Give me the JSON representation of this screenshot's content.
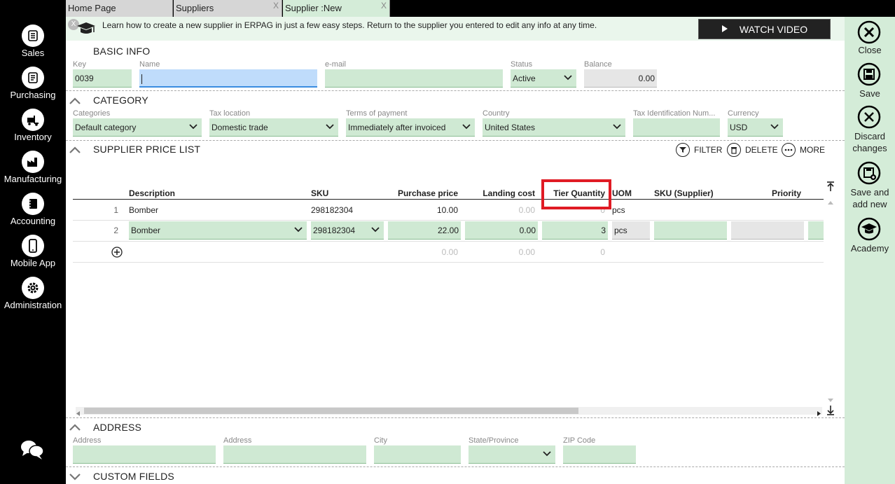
{
  "nav": {
    "items": [
      {
        "label": "Sales",
        "icon": "sales-icon"
      },
      {
        "label": "Purchasing",
        "icon": "purchasing-icon"
      },
      {
        "label": "Inventory",
        "icon": "inventory-icon"
      },
      {
        "label": "Manufacturing",
        "icon": "manufacturing-icon"
      },
      {
        "label": "Accounting",
        "icon": "accounting-icon"
      },
      {
        "label": "Mobile App",
        "icon": "mobile-icon"
      },
      {
        "label": "Administration",
        "icon": "gear-icon"
      }
    ]
  },
  "tabs": [
    {
      "label": "Home Page"
    },
    {
      "label": "Suppliers",
      "close": "X"
    },
    {
      "label": "Supplier :New",
      "close": "X"
    }
  ],
  "banner": {
    "close": "X",
    "text": "Learn how to create a new supplier in ERPAG in just a few easy steps. Return to the supplier you entered to edit any info at any time.",
    "watch_video": "WATCH VIDEO"
  },
  "basic_info": {
    "title": "BASIC INFO",
    "key_label": "Key",
    "key_value": "0039",
    "name_label": "Name",
    "name_value": "",
    "email_label": "e-mail",
    "email_value": "",
    "status_label": "Status",
    "status_value": "Active",
    "balance_label": "Balance",
    "balance_value": "0.00"
  },
  "category": {
    "title": "CATEGORY",
    "categories_label": "Categories",
    "categories_value": "Default category",
    "tax_location_label": "Tax location",
    "tax_location_value": "Domestic trade",
    "terms_label": "Terms of payment",
    "terms_value": "Immediately after invoiced",
    "country_label": "Country",
    "country_value": "United States",
    "tax_id_label": "Tax Identification Num...",
    "tax_id_value": "",
    "currency_label": "Currency",
    "currency_value": "USD"
  },
  "price_list": {
    "title": "SUPPLIER PRICE LIST",
    "filter": "FILTER",
    "delete": "DELETE",
    "more": "MORE",
    "columns": {
      "description": "Description",
      "sku": "SKU",
      "purchase_price": "Purchase price",
      "landing_cost": "Landing cost",
      "tier_quantity": "Tier Quantity",
      "uom": "UOM",
      "sku_supplier": "SKU (Supplier)",
      "priority": "Priority"
    },
    "rows": [
      {
        "num": "1",
        "description": "Bomber",
        "sku": "298182304",
        "purchase_price": "10.00",
        "landing_cost": "0.00",
        "tier_quantity": "0",
        "uom": "pcs"
      },
      {
        "num": "2",
        "description": "Bomber",
        "sku": "298182304",
        "purchase_price": "22.00",
        "landing_cost": "0.00",
        "tier_quantity": "3",
        "uom": "pcs"
      }
    ],
    "new_row": {
      "purchase_price": "0.00",
      "landing_cost": "0.00",
      "tier_quantity": "0"
    }
  },
  "address": {
    "title": "ADDRESS",
    "address1_label": "Address",
    "address2_label": "Address",
    "city_label": "City",
    "state_label": "State/Province",
    "zip_label": "ZIP Code"
  },
  "custom_fields": {
    "title": "CUSTOM FIELDS"
  },
  "actions": {
    "close": "Close",
    "save": "Save",
    "discard_1": "Discard",
    "discard_2": "changes",
    "save_new_1": "Save and",
    "save_new_2": "add new",
    "academy": "Academy"
  },
  "colors": {
    "accent_green": "#cfe9d3",
    "highlight_red": "#e01b24",
    "focus_blue": "#bfdcfb"
  }
}
